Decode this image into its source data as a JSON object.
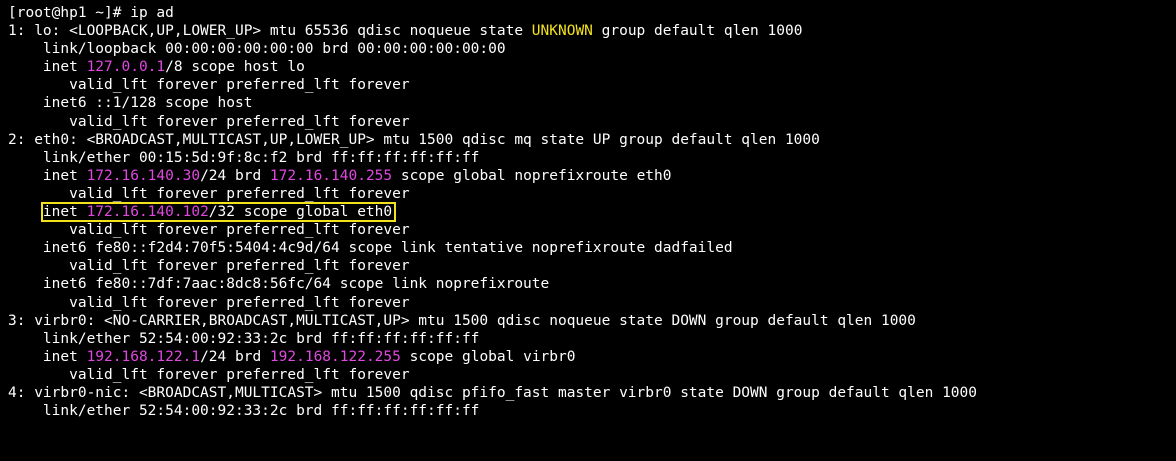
{
  "colors": {
    "background": "#000000",
    "default_text": "#ffffff",
    "ip_address": "#e048e0",
    "state_unknown": "#f2e21b",
    "highlight_box": "#f2e21b"
  },
  "terminal": {
    "lines": [
      {
        "segments": [
          {
            "text": "[root@hp1 ~]# ip ad"
          }
        ]
      },
      {
        "segments": [
          {
            "text": "1: lo: <LOOPBACK,UP,LOWER_UP> mtu 65536 qdisc noqueue state "
          },
          {
            "text": "UNKNOWN",
            "color": "#f2e21b"
          },
          {
            "text": " group default qlen 1000"
          }
        ]
      },
      {
        "segments": [
          {
            "text": "    link/loopback 00:00:00:00:00:00 brd 00:00:00:00:00:00"
          }
        ]
      },
      {
        "segments": [
          {
            "text": "    inet "
          },
          {
            "text": "127.0.0.1",
            "color": "#e048e0"
          },
          {
            "text": "/8 scope host lo"
          }
        ]
      },
      {
        "segments": [
          {
            "text": "       valid_lft forever preferred_lft forever"
          }
        ]
      },
      {
        "segments": [
          {
            "text": "    inet6 ::1/128 scope host"
          }
        ]
      },
      {
        "segments": [
          {
            "text": "       valid_lft forever preferred_lft forever"
          }
        ]
      },
      {
        "segments": [
          {
            "text": "2: eth0: <BROADCAST,MULTICAST,UP,LOWER_UP> mtu 1500 qdisc mq state UP group default qlen 1000"
          }
        ]
      },
      {
        "segments": [
          {
            "text": "    link/ether 00:15:5d:9f:8c:f2 brd ff:ff:ff:ff:ff:ff"
          }
        ]
      },
      {
        "segments": [
          {
            "text": "    inet "
          },
          {
            "text": "172.16.140.30",
            "color": "#e048e0"
          },
          {
            "text": "/24 brd "
          },
          {
            "text": "172.16.140.255",
            "color": "#e048e0"
          },
          {
            "text": " scope global noprefixroute eth0"
          }
        ]
      },
      {
        "segments": [
          {
            "text": "       valid_lft forever preferred_lft forever"
          }
        ]
      },
      {
        "highlight": true,
        "segments": [
          {
            "text": "    "
          },
          {
            "text": "inet ",
            "box": true
          },
          {
            "text": "172.16.140.102",
            "color": "#e048e0",
            "box": true
          },
          {
            "text": "/32 scope global eth0",
            "box": true
          }
        ]
      },
      {
        "segments": [
          {
            "text": "       valid_lft forever preferred_lft forever"
          }
        ]
      },
      {
        "segments": [
          {
            "text": "    inet6 fe80::f2d4:70f5:5404:4c9d/64 scope link tentative noprefixroute dadfailed"
          }
        ]
      },
      {
        "segments": [
          {
            "text": "       valid_lft forever preferred_lft forever"
          }
        ]
      },
      {
        "segments": [
          {
            "text": "    inet6 fe80::7df:7aac:8dc8:56fc/64 scope link noprefixroute"
          }
        ]
      },
      {
        "segments": [
          {
            "text": "       valid_lft forever preferred_lft forever"
          }
        ]
      },
      {
        "segments": [
          {
            "text": "3: virbr0: <NO-CARRIER,BROADCAST,MULTICAST,UP> mtu 1500 qdisc noqueue state DOWN group default qlen 1000"
          }
        ]
      },
      {
        "segments": [
          {
            "text": "    link/ether 52:54:00:92:33:2c brd ff:ff:ff:ff:ff:ff"
          }
        ]
      },
      {
        "segments": [
          {
            "text": "    inet "
          },
          {
            "text": "192.168.122.1",
            "color": "#e048e0"
          },
          {
            "text": "/24 brd "
          },
          {
            "text": "192.168.122.255",
            "color": "#e048e0"
          },
          {
            "text": " scope global virbr0"
          }
        ]
      },
      {
        "segments": [
          {
            "text": "       valid_lft forever preferred_lft forever"
          }
        ]
      },
      {
        "segments": [
          {
            "text": "4: virbr0-nic: <BROADCAST,MULTICAST> mtu 1500 qdisc pfifo_fast master virbr0 state DOWN group default qlen 1000"
          }
        ]
      },
      {
        "segments": [
          {
            "text": "    link/ether 52:54:00:92:33:2c brd ff:ff:ff:ff:ff:ff"
          }
        ]
      }
    ]
  }
}
